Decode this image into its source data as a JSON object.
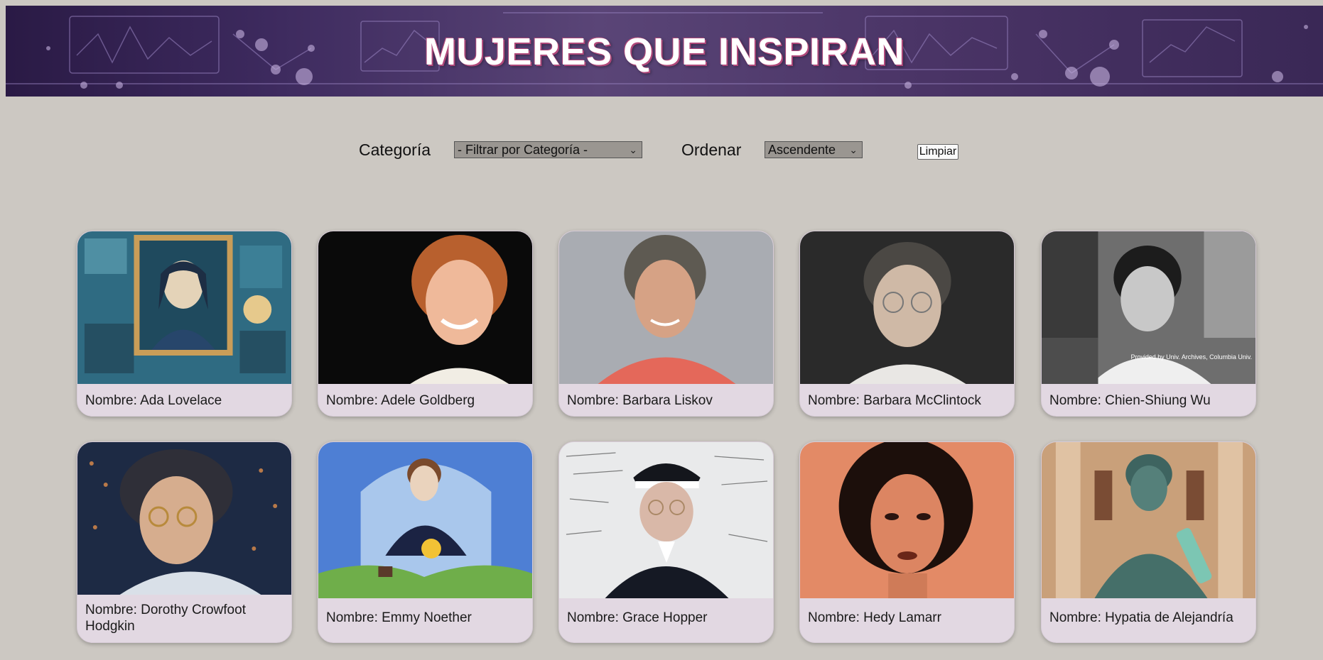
{
  "header": {
    "title": "MUJERES QUE INSPIRAN"
  },
  "filters": {
    "category_label": "Categoría",
    "category_selected": "- Filtrar por Categoría -",
    "order_label": "Ordenar",
    "order_selected": "Ascendente",
    "clear_button": "Limpiar"
  },
  "cards": [
    {
      "name": "Nombre: Ada Lovelace"
    },
    {
      "name": "Nombre: Adele Goldberg"
    },
    {
      "name": "Nombre: Barbara Liskov"
    },
    {
      "name": "Nombre: Barbara McClintock"
    },
    {
      "name": "Nombre: Chien-Shiung Wu"
    },
    {
      "name": "Nombre: Dorothy Crowfoot Hodgkin"
    },
    {
      "name": "Nombre: Emmy Noether"
    },
    {
      "name": "Nombre: Grace Hopper"
    },
    {
      "name": "Nombre: Hedy Lamarr"
    },
    {
      "name": "Nombre: Hypatia de Alejandría"
    }
  ],
  "photo_credit": "Provided by Univ. Archives, Columbia Univ.",
  "colors": {
    "page_bg": "#ccc8c2",
    "card_bg": "#e2d8e2",
    "banner_bg": "#3d2a5e",
    "title_shadow": "#b0487a"
  }
}
